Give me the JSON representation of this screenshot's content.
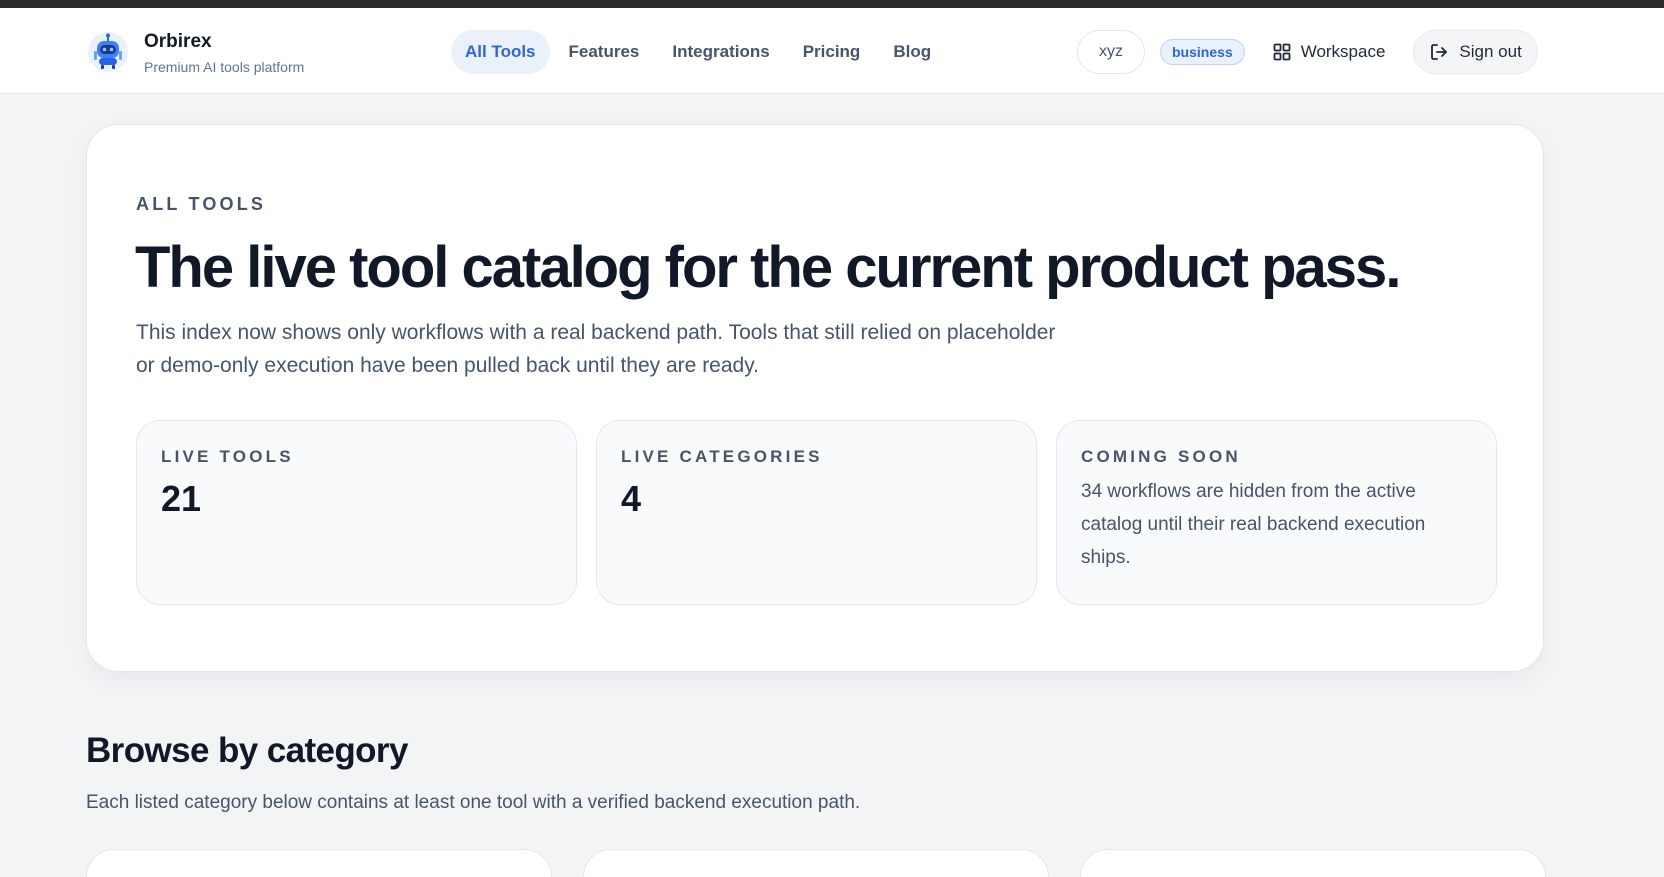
{
  "brand": {
    "name": "Orbirex",
    "tagline": "Premium AI tools platform",
    "logo_icon": "robot-icon"
  },
  "nav": {
    "links": [
      {
        "label": "All Tools",
        "active": true
      },
      {
        "label": "Features",
        "active": false
      },
      {
        "label": "Integrations",
        "active": false
      },
      {
        "label": "Pricing",
        "active": false
      },
      {
        "label": "Blog",
        "active": false
      }
    ]
  },
  "account": {
    "user": "xyz",
    "plan": "business",
    "workspace_label": "Workspace",
    "workspace_icon": "grid-icon",
    "signout_label": "Sign out",
    "signout_icon": "sign-out-icon"
  },
  "hero": {
    "eyebrow": "ALL TOOLS",
    "title": "The live tool catalog for the current product pass.",
    "description": "This index now shows only workflows with a real backend path. Tools that still relied on placeholder or demo-only execution have been pulled back until they are ready.",
    "stats": [
      {
        "label": "LIVE TOOLS",
        "value": "21"
      },
      {
        "label": "LIVE CATEGORIES",
        "value": "4"
      },
      {
        "label": "COMING SOON",
        "text": "34 workflows are hidden from the active catalog until their real backend execution ships."
      }
    ]
  },
  "browse": {
    "title": "Browse by category",
    "subtitle": "Each listed category below contains at least one tool with a verified backend execution path."
  },
  "colors": {
    "accent": "#2f67d6",
    "accent_bg": "#eaf1fb",
    "page_bg": "#f3f4f6",
    "heading": "#111827",
    "muted": "#475569"
  }
}
